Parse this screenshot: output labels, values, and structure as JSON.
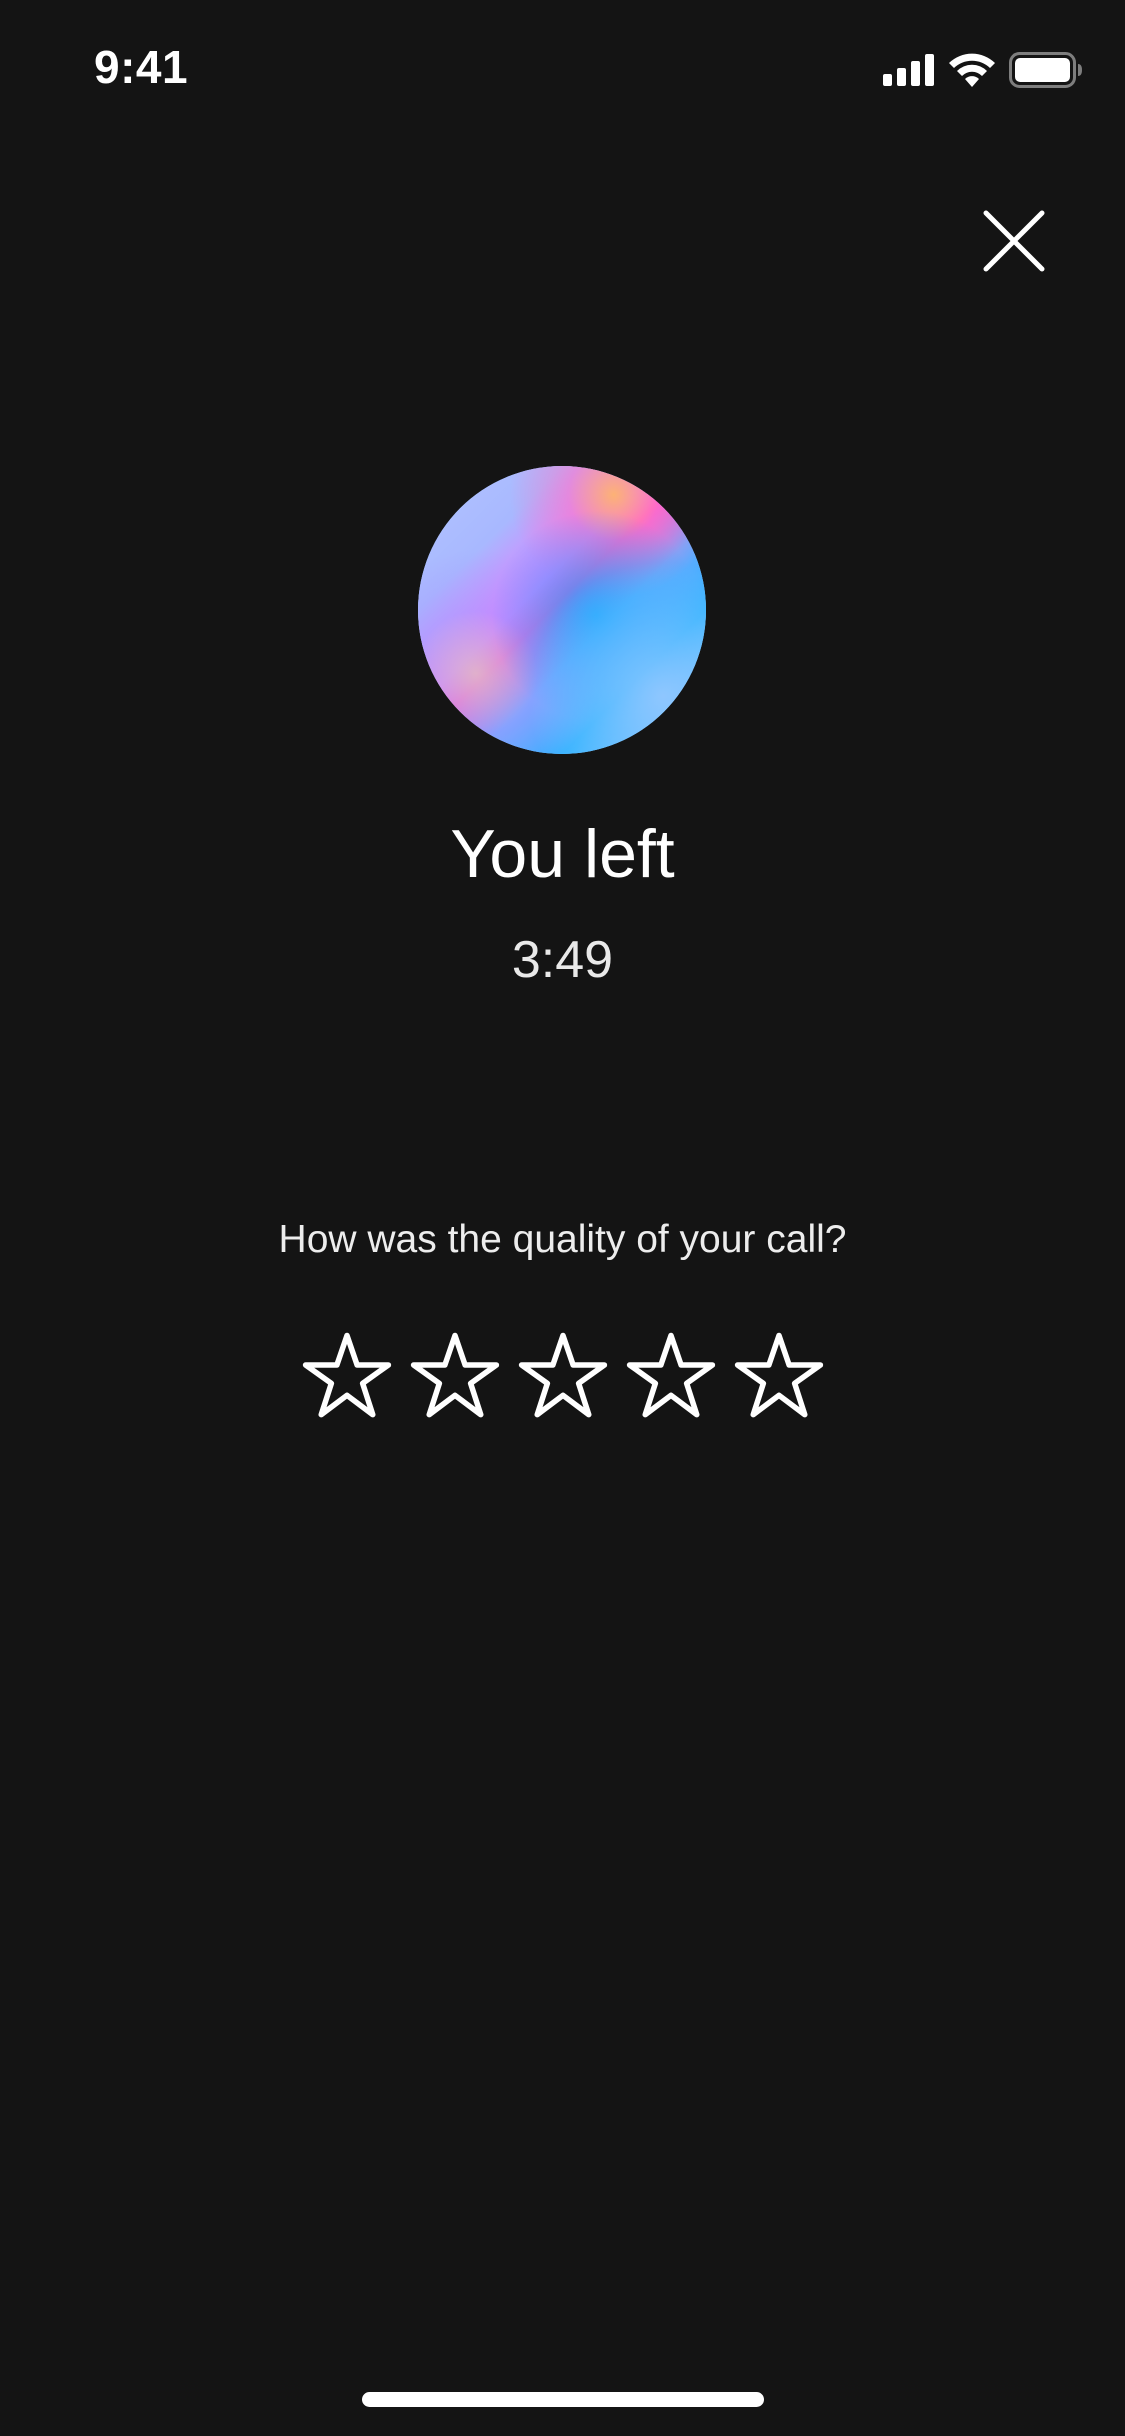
{
  "status_bar": {
    "time": "9:41",
    "icons": [
      "cellular-signal-icon",
      "wifi-icon",
      "battery-icon"
    ]
  },
  "header": {
    "close_icon": "close-icon"
  },
  "call_summary": {
    "title": "You left",
    "duration": "3:49"
  },
  "rating": {
    "question": "How was the quality of your call?",
    "max_stars": 5,
    "selected": 0
  },
  "colors": {
    "background": "#141414",
    "text": "#ffffff"
  }
}
